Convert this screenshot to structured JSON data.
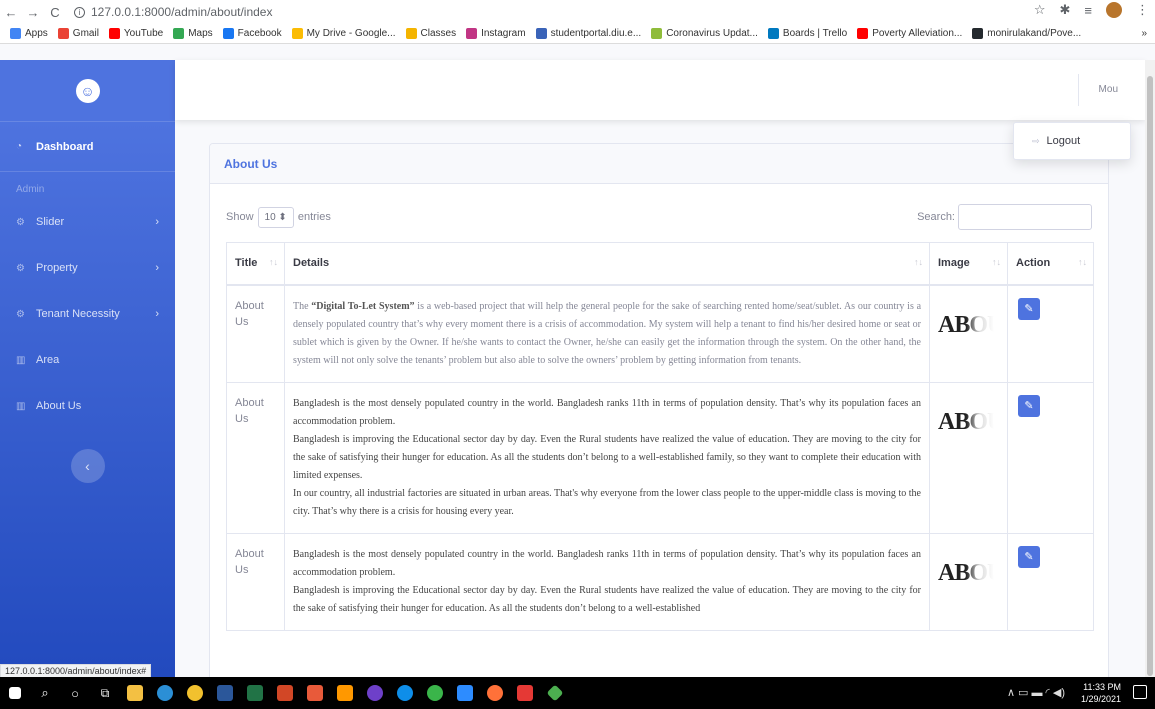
{
  "browser": {
    "url": "127.0.0.1:8000/admin/about/index",
    "status_url": "127.0.0.1:8000/admin/about/index#",
    "bookmarks": [
      {
        "label": "Apps",
        "color": "#4285f4"
      },
      {
        "label": "Gmail",
        "color": "#ea4335"
      },
      {
        "label": "YouTube",
        "color": "#ff0000"
      },
      {
        "label": "Maps",
        "color": "#34a853"
      },
      {
        "label": "Facebook",
        "color": "#1877f2"
      },
      {
        "label": "My Drive - Google...",
        "color": "#fbbc04"
      },
      {
        "label": "Classes",
        "color": "#f4b400"
      },
      {
        "label": "Instagram",
        "color": "#c13584"
      },
      {
        "label": "studentportal.diu.e...",
        "color": "#3a63b8"
      },
      {
        "label": "Coronavirus Updat...",
        "color": "#8fbc3a"
      },
      {
        "label": "Boards | Trello",
        "color": "#0079bf"
      },
      {
        "label": "Poverty Alleviation...",
        "color": "#ff0000"
      },
      {
        "label": "monirulakand/Pove...",
        "color": "#24292e"
      }
    ],
    "more": "»"
  },
  "sidebar": {
    "dashboard": "Dashboard",
    "heading": "Admin",
    "items": [
      {
        "label": "Slider",
        "chevron": "›"
      },
      {
        "label": "Property",
        "chevron": "›"
      },
      {
        "label": "Tenant Necessity",
        "chevron": "›"
      },
      {
        "label": "Area",
        "chevron": ""
      },
      {
        "label": "About Us",
        "chevron": ""
      }
    ],
    "collapse": "‹"
  },
  "topbar": {
    "user": "Mou"
  },
  "dropdown": {
    "logout": "Logout"
  },
  "card": {
    "title": "About Us",
    "show": "Show",
    "page_size": "10",
    "entries": "entries",
    "search": "Search:"
  },
  "table": {
    "headers": [
      "Title",
      "Details",
      "Image",
      "Action"
    ],
    "image_text": "ABOUT",
    "rows": [
      {
        "title": "About Us",
        "details_html": "The <b>“Digital To-Let System”</b> is a web-based project that will help the general people for the sake of searching rented home/seat/sublet. As our country is a densely populated country that’s why every moment there is a crisis of accommodation. My system will help a tenant to find his/her desired home or seat or sublet which is given by the Owner. If he/she wants to contact the Owner, he/she can easily get the information through the system. On the other hand, the system will not only solve the tenants’ problem but also able to solve the owners’ problem by getting information from tenants.",
        "faded": true
      },
      {
        "title": "About Us",
        "details_html": "Bangladesh is the most densely populated country in the world. Bangladesh ranks 11th in terms of population density. That’s why its population faces an accommodation problem.<br>Bangladesh is improving the Educational sector day by day. Even the Rural students have realized the value of education. They are moving to the city for the sake of satisfying their hunger for education. As all the students don’t belong to a well-established family, so they want to complete their education with limited expenses.<br>In our country, all industrial factories are situated in urban areas. That's why everyone from the lower class people to the upper-middle class is moving to the city. That’s why there is a crisis for housing every year.",
        "faded": false
      },
      {
        "title": "About Us",
        "details_html": "Bangladesh is the most densely populated country in the world. Bangladesh ranks 11th in terms of population density. That’s why its population faces an accommodation problem.<br>Bangladesh is improving the Educational sector day by day. Even the Rural students have realized the value of education. They are moving to the city for the sake of satisfying their hunger for education. As all the students don’t belong to a well-established",
        "faded": false
      }
    ]
  },
  "taskbar": {
    "time": "11:33 PM",
    "date": "1/29/2021"
  }
}
